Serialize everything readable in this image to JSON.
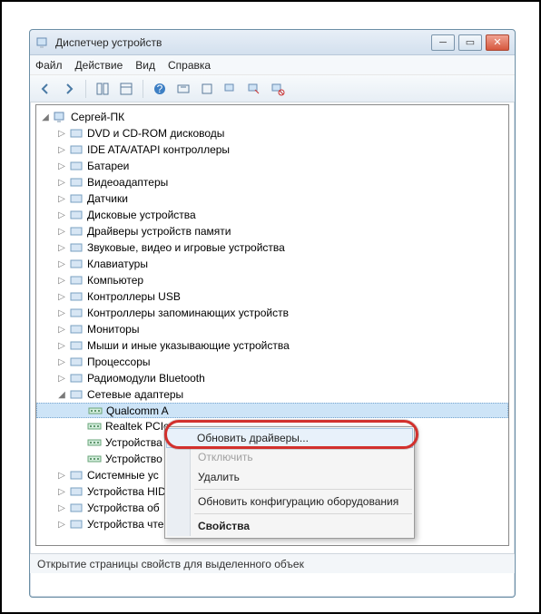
{
  "window": {
    "title": "Диспетчер устройств"
  },
  "menus": {
    "file": "Файл",
    "action": "Действие",
    "view": "Вид",
    "help": "Справка"
  },
  "tree": {
    "root": "Сергей-ПК",
    "items": [
      "DVD и CD-ROM дисководы",
      "IDE ATA/ATAPI контроллеры",
      "Батареи",
      "Видеоадаптеры",
      "Датчики",
      "Дисковые устройства",
      "Драйверы устройств памяти",
      "Звуковые, видео и игровые устройства",
      "Клавиатуры",
      "Компьютер",
      "Контроллеры USB",
      "Контроллеры запоминающих устройств",
      "Мониторы",
      "Мыши и иные указывающие устройства",
      "Процессоры",
      "Радиомодули Bluetooth",
      "Сетевые адаптеры"
    ],
    "net_children": [
      "Qualcomm A",
      "Realtek PCIe",
      "Устройства B",
      "Устройство B"
    ],
    "tail": [
      "Системные ус",
      "Устройства HID",
      "Устройства об",
      "Устройства чтения смарт-карт"
    ]
  },
  "context": {
    "update": "Обновить драйверы...",
    "disable": "Отключить",
    "remove": "Удалить",
    "scan": "Обновить конфигурацию оборудования",
    "props": "Свойства"
  },
  "status": "Открытие страницы свойств для выделенного объек"
}
